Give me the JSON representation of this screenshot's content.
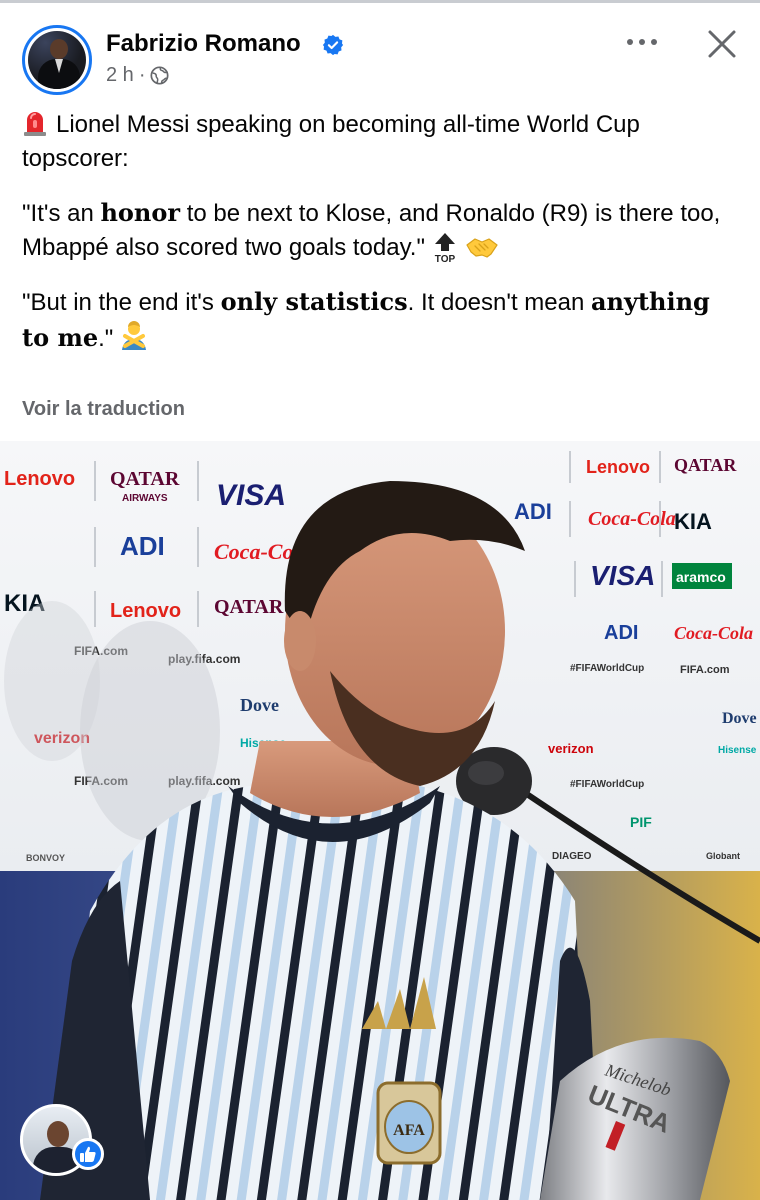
{
  "post": {
    "author": "Fabrizio Romano",
    "time": "2 h",
    "separator": "·",
    "paragraphs": [
      [
        {
          "text": "Lionel Messi speaking on becoming all-time World Cup topscorer:",
          "bold": false
        }
      ],
      [
        {
          "text": "\"It's an ",
          "bold": false
        },
        {
          "text": "honor",
          "bold": true
        },
        {
          "text": " to be next to Klose, and Ronaldo (R9) is there too, Mbappé also scored two goals today.\"",
          "bold": false
        }
      ],
      [
        {
          "text": "\"But in the end it's ",
          "bold": false
        },
        {
          "text": "only statistics",
          "bold": true
        },
        {
          "text": ". It doesn't mean ",
          "bold": false
        },
        {
          "text": "anything to me",
          "bold": true
        },
        {
          "text": ".\"",
          "bold": false
        }
      ]
    ],
    "translate_label": "Voir la traduction"
  },
  "photo_text": {
    "sponsors": [
      "Lenovo",
      "QATAR",
      "AIRWAYS",
      "VISA",
      "ADI",
      "Coca-Cola",
      "KIA",
      "aramco",
      "FIFA.com",
      "play.fifa.com",
      "#FIFAWorldCup",
      "verizon",
      "Dove",
      "Hisense",
      "ULTRA",
      "PIF",
      "DIAGEO",
      "BONVOY",
      "Globant"
    ],
    "trophy_text": [
      "Michelob",
      "ULTRA"
    ],
    "badge_text": "AFA"
  },
  "icons": {
    "verified": "verified-badge-icon",
    "globe": "globe-icon",
    "more": "more-options-icon",
    "close": "close-icon",
    "siren": "police-light-emoji",
    "top": "top-arrow-emoji",
    "handshake": "handshake-emoji",
    "no_gesture": "person-gesturing-no-emoji",
    "like": "like-thumb-icon"
  },
  "colors": {
    "accent": "#1877f2",
    "secondary_text": "#65676b",
    "primary_text": "#050505"
  }
}
